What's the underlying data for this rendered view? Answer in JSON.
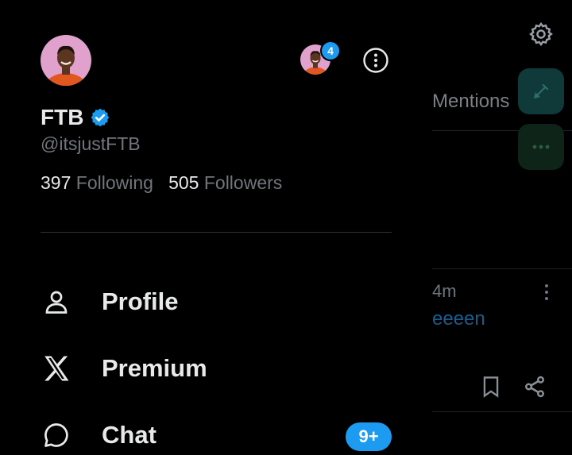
{
  "profile": {
    "display_name": "FTB",
    "handle": "@itsjustFTB",
    "following_count": "397",
    "following_label": "Following",
    "followers_count": "505",
    "followers_label": "Followers",
    "accounts_badge": "4",
    "verified": true
  },
  "nav": {
    "items": [
      {
        "label": "Profile",
        "icon": "person-icon"
      },
      {
        "label": "Premium",
        "icon": "x-logo-icon"
      },
      {
        "label": "Chat",
        "icon": "chat-bubble-icon",
        "badge": "9+"
      }
    ]
  },
  "background": {
    "tab_label": "Mentions",
    "post_time": "4m",
    "post_text": "eeeen"
  },
  "colors": {
    "accent": "#1d9bf0",
    "text_primary": "#e7e9ea",
    "text_secondary": "#71767b",
    "background": "#000000"
  }
}
